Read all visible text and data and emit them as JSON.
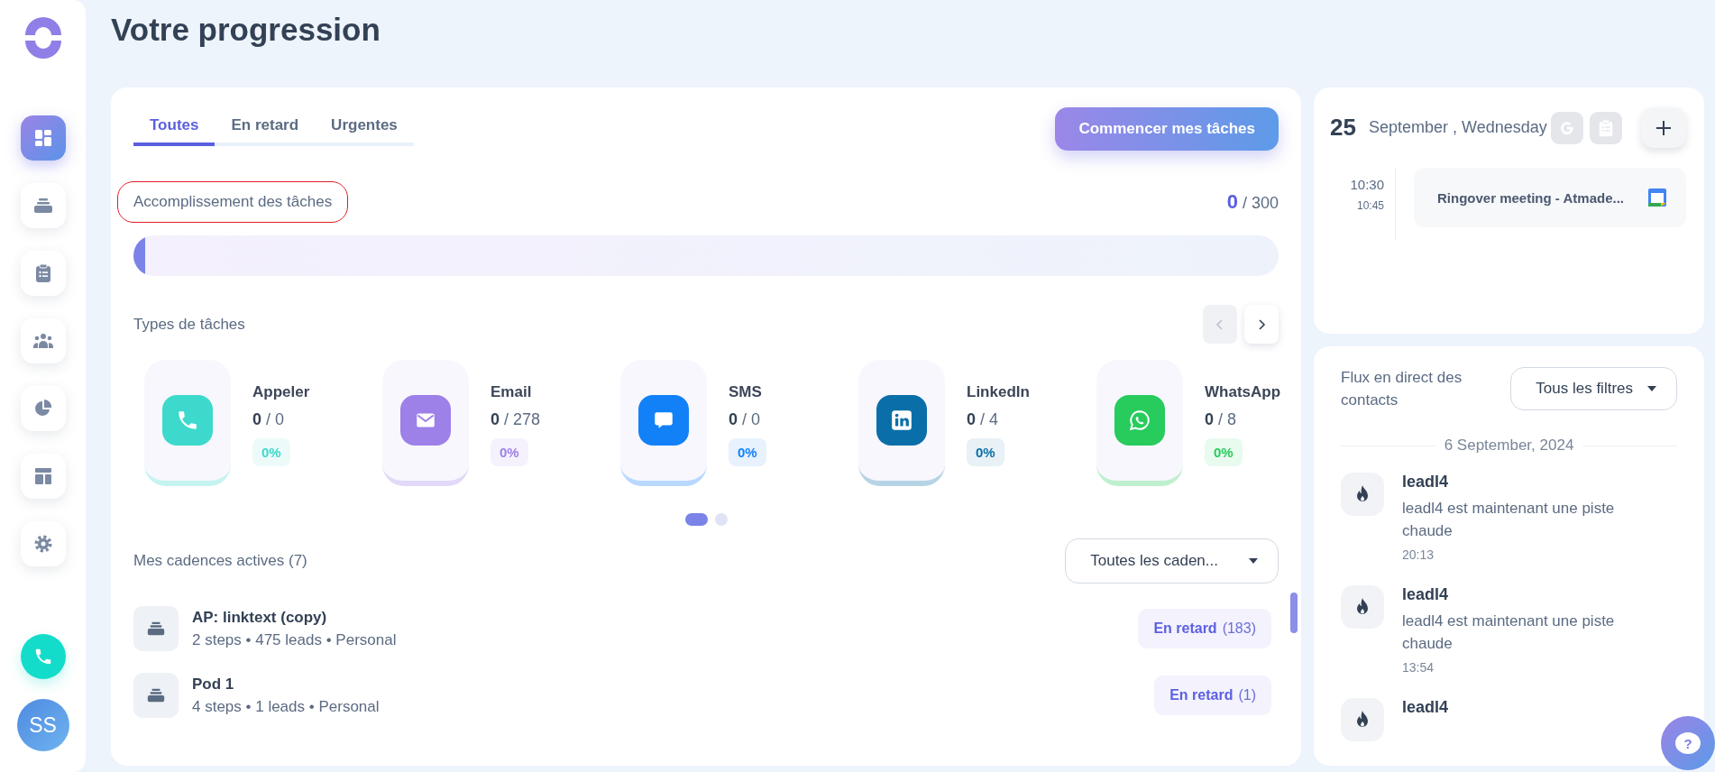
{
  "sidebar": {
    "items": [
      {
        "kind": "dashboard",
        "selected": true
      },
      {
        "kind": "cadences",
        "selected": false
      },
      {
        "kind": "tasks",
        "selected": false
      },
      {
        "kind": "contacts",
        "selected": false
      },
      {
        "kind": "reports",
        "selected": false
      },
      {
        "kind": "templates",
        "selected": false
      },
      {
        "kind": "settings",
        "selected": false
      }
    ],
    "avatar": {
      "initials": "SS"
    }
  },
  "page_title": "Votre progression",
  "progress_panel": {
    "tabs": [
      {
        "label": "Toutes",
        "selected": true
      },
      {
        "label": "En retard",
        "selected": false
      },
      {
        "label": "Urgentes",
        "selected": false
      }
    ],
    "start_button": "Commencer mes tâches",
    "completion": {
      "label": "Accomplissement des tâches",
      "highlighted": true,
      "done": "0",
      "total": "/ 300",
      "level": 0.01
    },
    "task_types": {
      "title": "Types de tâches",
      "arrows": [
        {
          "kind": "prev",
          "disabled": true
        },
        {
          "kind": "next",
          "disabled": false
        }
      ],
      "items": [
        {
          "kind": "call",
          "name": "Appeler",
          "done": "0",
          "total": "/ 0",
          "percent": "0%",
          "color": "#3dd9cc"
        },
        {
          "kind": "email",
          "name": "Email",
          "done": "0",
          "total": "/ 278",
          "percent": "0%",
          "color": "#9d80e8"
        },
        {
          "kind": "sms",
          "name": "SMS",
          "done": "0",
          "total": "/ 0",
          "percent": "0%",
          "color": "#1281f8"
        },
        {
          "kind": "linkedin",
          "name": "LinkedIn",
          "done": "0",
          "total": "/ 4",
          "percent": "0%",
          "color": "#0a6fa8"
        },
        {
          "kind": "whatsapp",
          "name": "WhatsApp",
          "done": "0",
          "total": "/ 8",
          "percent": "0%",
          "color": "#27cc5c"
        }
      ],
      "pages": [
        {
          "selected": true
        },
        {
          "selected": false
        }
      ]
    },
    "cadences": {
      "title": "Mes cadences actives (7)",
      "filter": "Toutes les caden...",
      "rows": [
        {
          "name": "AP: linktext (copy)",
          "details": "2 steps • 475 leads • Personal",
          "status": "En retard",
          "count": "(183)"
        },
        {
          "name": "Pod 1",
          "details": "4 steps • 1 leads • Personal",
          "status": "En retard",
          "count": "(1)"
        }
      ]
    }
  },
  "calendar": {
    "day": "25",
    "date": "September , Wednesday",
    "events": [
      {
        "start": "10:30",
        "end": "10:45",
        "title": "Ringover meeting - Atmade..."
      }
    ]
  },
  "feed": {
    "title": "Flux en direct des contacts",
    "filter": "Tous les filtres",
    "date": "6 September, 2024",
    "items": [
      {
        "name": "leadl4",
        "message": "leadl4 est maintenant une piste chaude",
        "time": "20:13"
      },
      {
        "name": "leadl4",
        "message": "leadl4 est maintenant une piste chaude",
        "time": "13:54"
      },
      {
        "name": "leadl4"
      }
    ]
  },
  "help_button": {
    "label": "?"
  }
}
